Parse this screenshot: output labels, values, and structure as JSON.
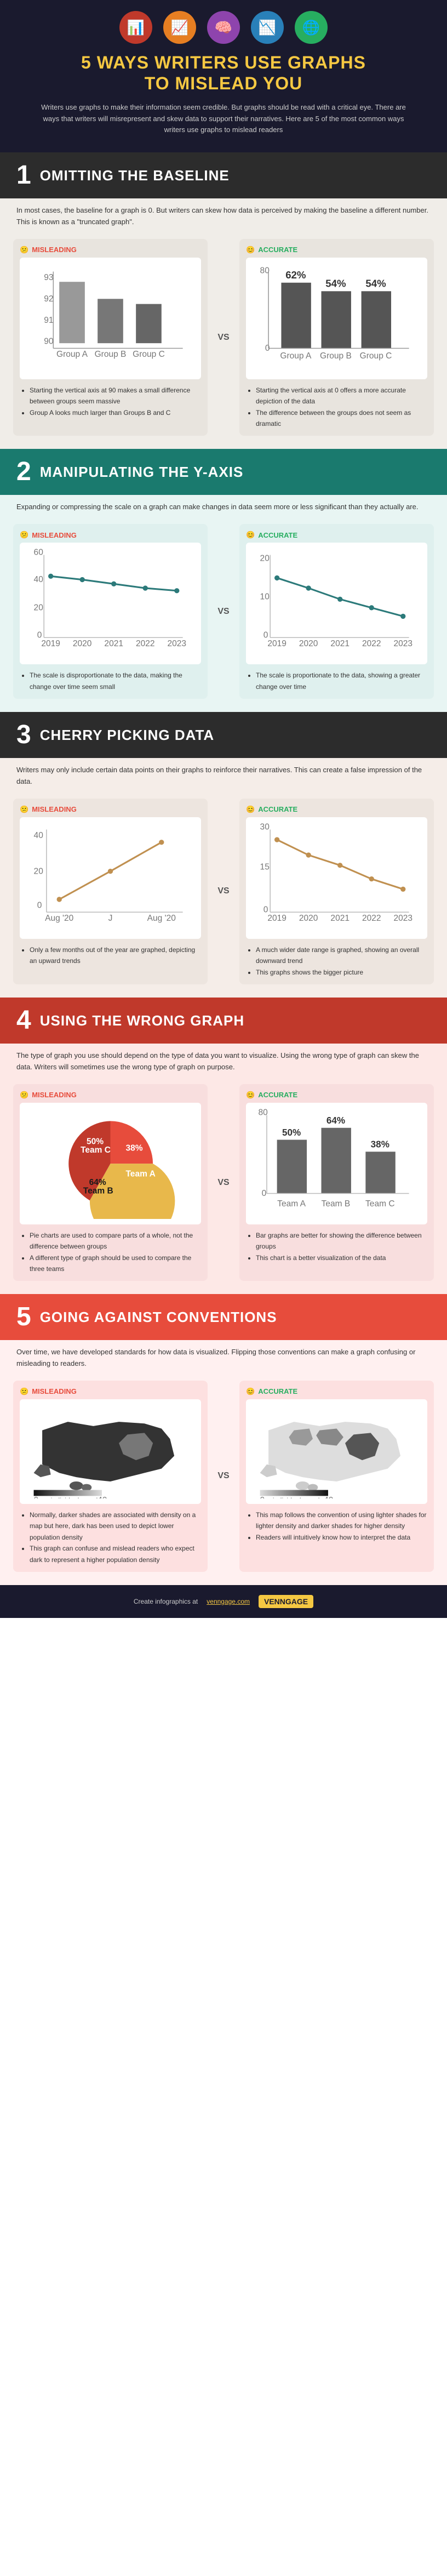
{
  "header": {
    "title_line1": "5 WAYS WRITERS USE GRAPHS",
    "title_line2": "TO MISLEAD YOU",
    "subtitle": "Writers use graphs to make their information seem credible. But graphs should be read with a critical eye. There are ways that writers will misrepresent and skew data to support their narratives. Here are 5 of the most common ways writers use graphs to mislead readers",
    "icons": [
      "📊",
      "📈",
      "🧠",
      "📉",
      "🌐"
    ]
  },
  "sections": [
    {
      "number": "1",
      "title": "OMITTING THE BASELINE",
      "desc": "In most cases, the baseline for a graph is 0. But writers can skew how data is perceived by making the baseline a different number. This is known as a \"truncated graph\".",
      "misleading_label": "MISLEADING",
      "accurate_label": "ACCURATE",
      "misleading_bullets": [
        "Starting the vertical axis at 90 makes a small difference between groups seem massive",
        "Group A looks much larger than Groups B and C"
      ],
      "accurate_bullets": [
        "Starting the vertical axis at 0 offers a more accurate depiction of the data",
        "The difference between the groups does not seem as dramatic"
      ],
      "chart1": {
        "type": "bar",
        "ymin": 90,
        "ymax": 93,
        "yticks": [
          "90",
          "91",
          "92",
          "93"
        ],
        "groups": [
          "Group A",
          "Group B",
          "Group C"
        ],
        "values": [
          92.7,
          91.5,
          91.2
        ],
        "color": "#b0b0b0"
      },
      "chart2": {
        "type": "bar",
        "ymin": 0,
        "ymax": 80,
        "groups": [
          "Group A",
          "Group B",
          "Group C"
        ],
        "values": [
          62,
          54,
          54
        ],
        "labels": [
          "62%",
          "54%",
          "54%"
        ],
        "color": "#4a4a4a"
      }
    },
    {
      "number": "2",
      "title": "MANIPULATING THE Y-AXIS",
      "desc": "Expanding or compressing the scale on a graph can make changes in data seem more or less significant than they actually are.",
      "misleading_label": "MISLEADING",
      "accurate_label": "ACCURATE",
      "misleading_bullets": [
        "The scale is disproportionate to the data, making the change over time seem small"
      ],
      "accurate_bullets": [
        "The scale is proportionate to the data, showing a greater change over time"
      ],
      "chart1": {
        "type": "line",
        "years": [
          "2019",
          "2020",
          "2021",
          "2022",
          "2023"
        ],
        "values": [
          40,
          38,
          35,
          32,
          30
        ],
        "ymin": 0,
        "ymax": 60,
        "color": "#2c7a7a"
      },
      "chart2": {
        "type": "line",
        "years": [
          "2019",
          "2020",
          "2021",
          "2022",
          "2023"
        ],
        "values": [
          14,
          12,
          9,
          7,
          5
        ],
        "ymin": 0,
        "ymax": 20,
        "color": "#2c7a7a"
      }
    },
    {
      "number": "3",
      "title": "CHERRY PICKING DATA",
      "desc": "Writers may only include certain data points on their graphs to reinforce their narratives. This can create a false impression of the data.",
      "misleading_label": "MISLEADING",
      "accurate_label": "ACCURATE",
      "misleading_bullets": [
        "Only a few months out of the year are graphed, depicting an upward trends"
      ],
      "accurate_bullets": [
        "A much wider date range is graphed, showing an overall downward trend",
        "This graphs shows the bigger picture"
      ],
      "chart1": {
        "type": "line",
        "labels": [
          "Aug '20",
          "J",
          "Aug '20"
        ],
        "values": [
          10,
          20,
          30
        ],
        "ymin": 0,
        "ymax": 40,
        "color": "#c0a060"
      },
      "chart2": {
        "type": "line",
        "labels": [
          "2019",
          "2020",
          "2021",
          "2022",
          "2023"
        ],
        "values": [
          30,
          22,
          18,
          12,
          8
        ],
        "ymin": 0,
        "ymax": 35,
        "color": "#c0a060"
      }
    },
    {
      "number": "4",
      "title": "USING THE WRONG GRAPH",
      "desc": "The type of graph you use should depend on the type of data you want to visualize. Using the wrong type of graph can skew the data. Writers will sometimes use the wrong type of graph on purpose.",
      "misleading_label": "MISLEADING",
      "accurate_label": "ACCURATE",
      "misleading_bullets": [
        "Pie charts are used to compare parts of a whole, not the difference between groups",
        "A different type of graph should be used to compare the three teams"
      ],
      "accurate_bullets": [
        "Bar graphs are better for showing the difference between groups",
        "This chart is a better visualization of the data"
      ],
      "pie": {
        "slices": [
          {
            "label": "Team A",
            "value": 38,
            "color": "#e74c3c"
          },
          {
            "label": "Team B",
            "value": 64,
            "color": "#e8b84b"
          },
          {
            "label": "Team C",
            "value": 50,
            "color": "#c0392b"
          }
        ]
      },
      "chart2": {
        "type": "bar",
        "groups": [
          "Team A",
          "Team B",
          "Team C"
        ],
        "values": [
          50,
          64,
          38
        ],
        "labels": [
          "50%",
          "64%",
          "38%"
        ],
        "color": "#555"
      }
    },
    {
      "number": "5",
      "title": "GOING AGAINST CONVENTIONS",
      "desc": "Over time, we have developed standards for how data is visualized. Flipping those conventions can make a graph confusing or misleading to readers.",
      "misleading_label": "MISLEADING",
      "accurate_label": "ACCURATE",
      "misleading_bullets": [
        "Normally, darker shades are associated with density on a map but here, dark has been used to depict lower population density",
        "This graph can confuse and mislead readers who expect dark to represent a higher population density"
      ],
      "accurate_bullets": [
        "This map follows the convention of using lighter shades for lighter density and darker shades for higher density",
        "Readers will intuitively know how to interpret the data"
      ],
      "misleading_map_note": "individuals per km",
      "accurate_map_note": "individuals per km"
    }
  ],
  "footer": {
    "text": "Create infographics at",
    "link": "venngage.com",
    "logo": "VENNGAGE"
  }
}
